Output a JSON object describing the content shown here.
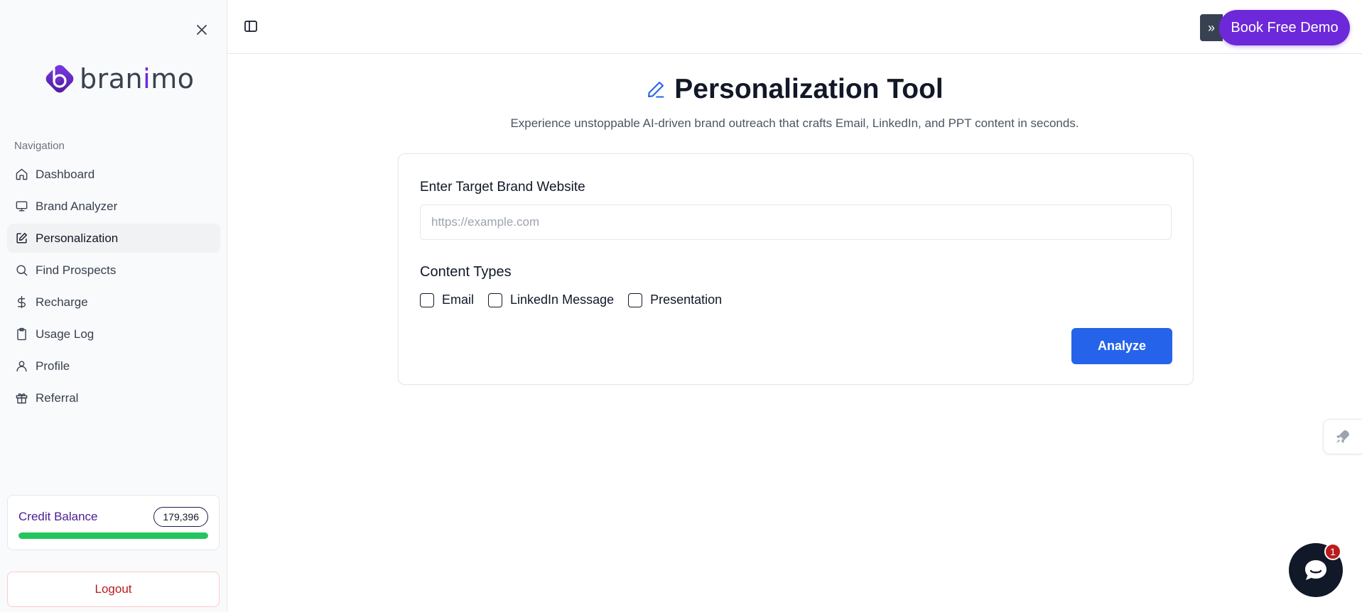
{
  "sidebar": {
    "brand": {
      "prefix": "bran",
      "accent": "i",
      "suffix": "mo"
    },
    "nav_heading": "Navigation",
    "items": [
      {
        "label": "Dashboard",
        "icon": "home-icon"
      },
      {
        "label": "Brand Analyzer",
        "icon": "monitor-icon"
      },
      {
        "label": "Personalization",
        "icon": "edit-icon",
        "active": true
      },
      {
        "label": "Find Prospects",
        "icon": "search-icon"
      },
      {
        "label": "Recharge",
        "icon": "dollar-icon"
      },
      {
        "label": "Usage Log",
        "icon": "clipboard-icon"
      },
      {
        "label": "Profile",
        "icon": "user-icon"
      },
      {
        "label": "Referral",
        "icon": "gift-icon"
      }
    ],
    "credit": {
      "label": "Credit Balance",
      "value": "179,396",
      "fill_percent": 100
    },
    "logout_label": "Logout"
  },
  "topbar": {
    "expand_label": "»",
    "demo_label": "Book Free Demo"
  },
  "main": {
    "title": "Personalization Tool",
    "subtitle": "Experience unstoppable AI-driven brand outreach that crafts Email, LinkedIn, and PPT content in seconds.",
    "form": {
      "website_label": "Enter Target Brand Website",
      "website_value": "",
      "website_placeholder": "https://example.com",
      "content_types_label": "Content Types",
      "options": [
        {
          "label": "Email",
          "checked": false
        },
        {
          "label": "LinkedIn Message",
          "checked": false
        },
        {
          "label": "Presentation",
          "checked": false
        }
      ],
      "submit_label": "Analyze"
    }
  },
  "chat": {
    "badge": "1"
  },
  "colors": {
    "brand_purple": "#6d28d9",
    "primary_blue": "#2563eb",
    "success_green": "#22c55e",
    "danger_red": "#b91c1c"
  }
}
